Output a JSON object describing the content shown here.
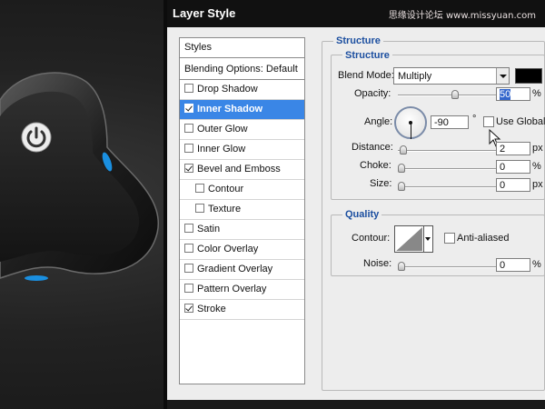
{
  "watermark": "思缘设计论坛 www.missyuan.com",
  "dialog": {
    "title": "Layer Style"
  },
  "styles_list": {
    "header": "Styles",
    "blending": "Blending Options: Default",
    "items": [
      {
        "label": "Drop Shadow",
        "checked": false,
        "selected": false
      },
      {
        "label": "Inner Shadow",
        "checked": true,
        "selected": true
      },
      {
        "label": "Outer Glow",
        "checked": false,
        "selected": false
      },
      {
        "label": "Inner Glow",
        "checked": false,
        "selected": false
      },
      {
        "label": "Bevel and Emboss",
        "checked": true,
        "selected": false
      },
      {
        "label": "Contour",
        "checked": false,
        "selected": false
      },
      {
        "label": "Texture",
        "checked": false,
        "selected": false
      },
      {
        "label": "Satin",
        "checked": false,
        "selected": false
      },
      {
        "label": "Color Overlay",
        "checked": false,
        "selected": false
      },
      {
        "label": "Gradient Overlay",
        "checked": false,
        "selected": false
      },
      {
        "label": "Pattern Overlay",
        "checked": false,
        "selected": false
      },
      {
        "label": "Stroke",
        "checked": true,
        "selected": false
      }
    ]
  },
  "inner_shadow": {
    "title": "Inner Shadow",
    "structure": {
      "title": "Structure",
      "blend_mode_label": "Blend Mode:",
      "blend_mode_value": "Multiply",
      "color": "#000000",
      "opacity_label": "Opacity:",
      "opacity_value": "50",
      "opacity_level": 50,
      "pct": "%",
      "angle_label": "Angle:",
      "angle_value": "-90",
      "degree": "°",
      "global_light_label": "Use Global Li",
      "distance_label": "Distance:",
      "distance_value": "2",
      "distance_level": 2,
      "px": "px",
      "choke_label": "Choke:",
      "choke_value": "0",
      "choke_level": 0,
      "size_label": "Size:",
      "size_value": "0",
      "size_level": 0
    },
    "quality": {
      "title": "Quality",
      "contour_label": "Contour:",
      "anti_aliased_label": "Anti-aliased",
      "noise_label": "Noise:",
      "noise_value": "0",
      "noise_level": 0
    }
  },
  "colors": {
    "accent": "#3a86e6",
    "title_blue": "#1c4fa0",
    "glow": "#1a8fe0"
  }
}
